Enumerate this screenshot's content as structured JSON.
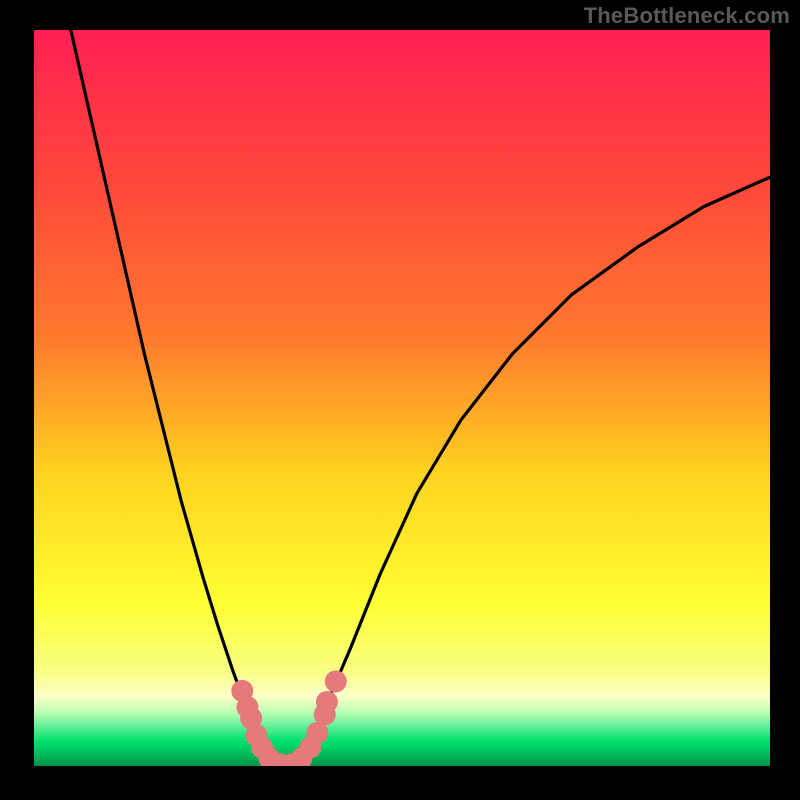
{
  "watermark": "TheBottleneck.com",
  "colors": {
    "gradient_top": "#ff1f52",
    "gradient_upper_mid": "#ff7a2e",
    "gradient_mid": "#ffd21f",
    "gradient_lower_mid": "#ffff33",
    "gradient_light": "#fdffc8",
    "gradient_green": "#00e36e",
    "gradient_bottom": "#00924a",
    "curve": "#000000",
    "marker_fill": "#e47a7b",
    "marker_stroke": "#d16465"
  },
  "chart_data": {
    "type": "line",
    "title": "",
    "xlabel": "",
    "ylabel": "",
    "xlim": [
      0,
      1
    ],
    "ylim": [
      0,
      1
    ],
    "series": [
      {
        "name": "curve",
        "x": [
          0.05,
          0.1,
          0.15,
          0.2,
          0.23,
          0.25,
          0.27,
          0.29,
          0.3,
          0.31,
          0.32,
          0.33,
          0.335,
          0.34,
          0.35,
          0.36,
          0.38,
          0.4,
          0.43,
          0.47,
          0.52,
          0.58,
          0.65,
          0.73,
          0.82,
          0.91,
          1.0
        ],
        "y": [
          1.0,
          0.78,
          0.56,
          0.36,
          0.255,
          0.19,
          0.13,
          0.075,
          0.05,
          0.03,
          0.015,
          0.005,
          0.0,
          0.0,
          0.005,
          0.015,
          0.045,
          0.09,
          0.16,
          0.26,
          0.37,
          0.47,
          0.56,
          0.64,
          0.705,
          0.76,
          0.8
        ]
      }
    ],
    "markers": [
      {
        "x": 0.283,
        "y": 0.102
      },
      {
        "x": 0.29,
        "y": 0.08
      },
      {
        "x": 0.295,
        "y": 0.065
      },
      {
        "x": 0.302,
        "y": 0.042
      },
      {
        "x": 0.31,
        "y": 0.025
      },
      {
        "x": 0.32,
        "y": 0.01
      },
      {
        "x": 0.335,
        "y": 0.002
      },
      {
        "x": 0.35,
        "y": 0.002
      },
      {
        "x": 0.363,
        "y": 0.01
      },
      {
        "x": 0.375,
        "y": 0.025
      },
      {
        "x": 0.385,
        "y": 0.045
      },
      {
        "x": 0.395,
        "y": 0.07
      },
      {
        "x": 0.398,
        "y": 0.087
      },
      {
        "x": 0.41,
        "y": 0.115
      }
    ]
  }
}
